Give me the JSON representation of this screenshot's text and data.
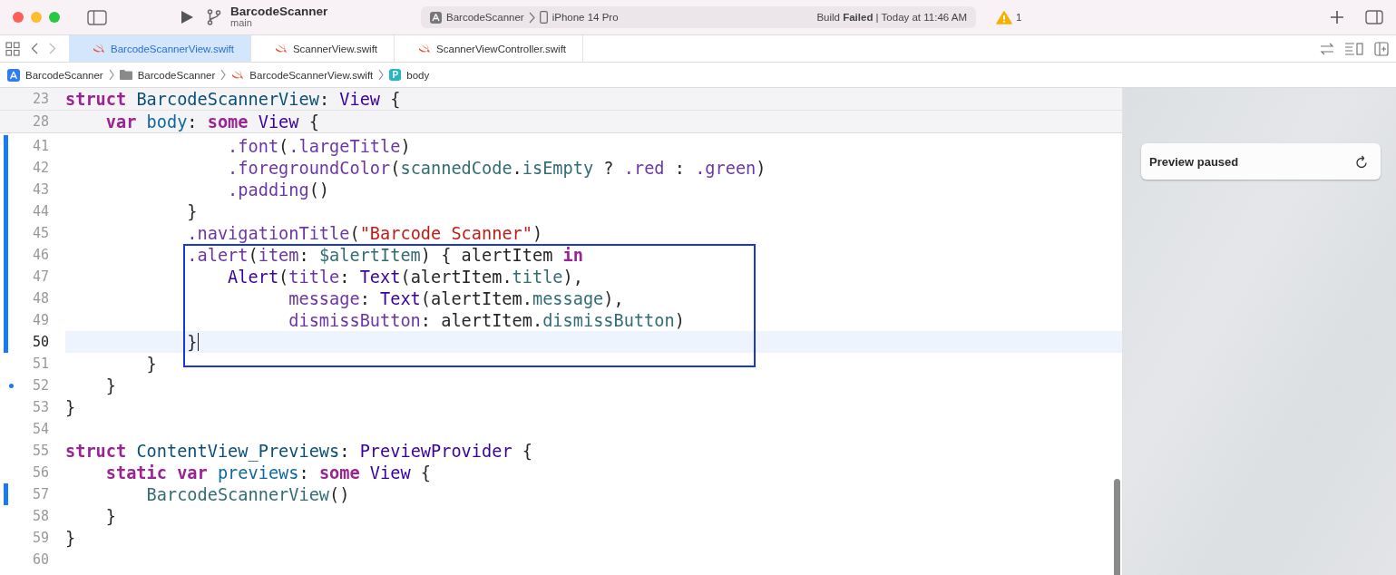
{
  "toolbar": {
    "project": "BarcodeScanner",
    "branch": "main",
    "scheme": "BarcodeScanner",
    "device": "iPhone 14 Pro",
    "status": "Build **Failed** | Today at 11:46 AM",
    "warning_count": "1"
  },
  "tabs": [
    {
      "label": "BarcodeScannerView.swift",
      "selected": true
    },
    {
      "label": "ScannerView.swift",
      "selected": false
    },
    {
      "label": "ScannerViewController.swift",
      "selected": false
    }
  ],
  "breadcrumb": [
    {
      "kind": "app",
      "label": "BarcodeScanner"
    },
    {
      "kind": "folder",
      "label": "BarcodeScanner"
    },
    {
      "kind": "swift",
      "label": "BarcodeScannerView.swift"
    },
    {
      "kind": "property",
      "badge": "P",
      "label": "body"
    }
  ],
  "sticky_lines": [
    {
      "number": "23",
      "tokens": [
        {
          "kind": "kw",
          "text": "struct "
        },
        {
          "kind": "decl",
          "text": "BarcodeScannerView"
        },
        {
          "kind": "p",
          "text": ": "
        },
        {
          "kind": "type",
          "text": "View"
        },
        {
          "kind": "p",
          "text": " {"
        }
      ]
    },
    {
      "number": "28",
      "tokens": [
        {
          "kind": "kw",
          "text": "    var "
        },
        {
          "kind": "var",
          "text": "body"
        },
        {
          "kind": "p",
          "text": ": "
        },
        {
          "kind": "kw",
          "text": "some "
        },
        {
          "kind": "type",
          "text": "View"
        },
        {
          "kind": "p",
          "text": " {"
        }
      ]
    }
  ],
  "lines": [
    {
      "number": "41",
      "changed": true,
      "deletion": false,
      "current": false,
      "boxed": false,
      "tokens": [
        {
          "kind": "member",
          "text": "                .font"
        },
        {
          "kind": "p",
          "text": "("
        },
        {
          "kind": "member",
          "text": ".largeTitle"
        },
        {
          "kind": "p",
          "text": ")"
        }
      ]
    },
    {
      "number": "42",
      "changed": true,
      "deletion": false,
      "current": false,
      "boxed": false,
      "tokens": [
        {
          "kind": "member",
          "text": "                .foregroundColor"
        },
        {
          "kind": "p",
          "text": "("
        },
        {
          "kind": "prop",
          "text": "scannedCode"
        },
        {
          "kind": "p",
          "text": "."
        },
        {
          "kind": "prop",
          "text": "isEmpty"
        },
        {
          "kind": "p",
          "text": " ? "
        },
        {
          "kind": "member",
          "text": ".red"
        },
        {
          "kind": "p",
          "text": " : "
        },
        {
          "kind": "member",
          "text": ".green"
        },
        {
          "kind": "p",
          "text": ")"
        }
      ]
    },
    {
      "number": "43",
      "changed": true,
      "deletion": false,
      "current": false,
      "boxed": false,
      "tokens": [
        {
          "kind": "member",
          "text": "                .padding"
        },
        {
          "kind": "p",
          "text": "()"
        }
      ]
    },
    {
      "number": "44",
      "changed": true,
      "deletion": false,
      "current": false,
      "boxed": false,
      "tokens": [
        {
          "kind": "p",
          "text": "            }"
        }
      ]
    },
    {
      "number": "45",
      "changed": true,
      "deletion": false,
      "current": false,
      "boxed": false,
      "tokens": [
        {
          "kind": "member",
          "text": "            .navigationTitle"
        },
        {
          "kind": "p",
          "text": "("
        },
        {
          "kind": "str",
          "text": "\"Barcode Scanner\""
        },
        {
          "kind": "p",
          "text": ")"
        }
      ]
    },
    {
      "number": "46",
      "changed": true,
      "deletion": false,
      "current": false,
      "boxed": true,
      "tokens": [
        {
          "kind": "member",
          "text": "            .alert"
        },
        {
          "kind": "p",
          "text": "("
        },
        {
          "kind": "member",
          "text": "item"
        },
        {
          "kind": "p",
          "text": ": "
        },
        {
          "kind": "prop",
          "text": "$alertItem"
        },
        {
          "kind": "p",
          "text": ") { alertItem "
        },
        {
          "kind": "kw",
          "text": "in"
        }
      ]
    },
    {
      "number": "47",
      "changed": true,
      "deletion": false,
      "current": false,
      "boxed": true,
      "tokens": [
        {
          "kind": "type",
          "text": "                Alert"
        },
        {
          "kind": "p",
          "text": "("
        },
        {
          "kind": "member",
          "text": "title"
        },
        {
          "kind": "p",
          "text": ": "
        },
        {
          "kind": "type",
          "text": "Text"
        },
        {
          "kind": "p",
          "text": "(alertItem."
        },
        {
          "kind": "prop",
          "text": "title"
        },
        {
          "kind": "p",
          "text": "),"
        }
      ]
    },
    {
      "number": "48",
      "changed": true,
      "deletion": false,
      "current": false,
      "boxed": true,
      "tokens": [
        {
          "kind": "member",
          "text": "                      message"
        },
        {
          "kind": "p",
          "text": ": "
        },
        {
          "kind": "type",
          "text": "Text"
        },
        {
          "kind": "p",
          "text": "(alertItem."
        },
        {
          "kind": "prop",
          "text": "message"
        },
        {
          "kind": "p",
          "text": "),"
        }
      ]
    },
    {
      "number": "49",
      "changed": true,
      "deletion": false,
      "current": false,
      "boxed": true,
      "tokens": [
        {
          "kind": "member",
          "text": "                      dismissButton"
        },
        {
          "kind": "p",
          "text": ": alertItem."
        },
        {
          "kind": "prop",
          "text": "dismissButton"
        },
        {
          "kind": "p",
          "text": ")"
        }
      ]
    },
    {
      "number": "50",
      "changed": true,
      "deletion": false,
      "current": true,
      "boxed": true,
      "tokens": [
        {
          "kind": "p",
          "text": "            }"
        }
      ]
    },
    {
      "number": "51",
      "changed": false,
      "deletion": false,
      "current": false,
      "boxed": false,
      "tokens": [
        {
          "kind": "p",
          "text": "        }"
        }
      ]
    },
    {
      "number": "52",
      "changed": false,
      "deletion": true,
      "current": false,
      "boxed": false,
      "tokens": [
        {
          "kind": "p",
          "text": "    }"
        }
      ]
    },
    {
      "number": "53",
      "changed": false,
      "deletion": false,
      "current": false,
      "boxed": false,
      "tokens": [
        {
          "kind": "p",
          "text": "}"
        }
      ]
    },
    {
      "number": "54",
      "changed": false,
      "deletion": false,
      "current": false,
      "boxed": false
    },
    {
      "number": "55",
      "changed": false,
      "deletion": false,
      "current": false,
      "boxed": false,
      "tokens": [
        {
          "kind": "kw",
          "text": "struct "
        },
        {
          "kind": "decl",
          "text": "ContentView_Previews"
        },
        {
          "kind": "p",
          "text": ": "
        },
        {
          "kind": "type",
          "text": "PreviewProvider"
        },
        {
          "kind": "p",
          "text": " {"
        }
      ]
    },
    {
      "number": "56",
      "changed": false,
      "deletion": false,
      "current": false,
      "boxed": false,
      "tokens": [
        {
          "kind": "kw",
          "text": "    static var "
        },
        {
          "kind": "var",
          "text": "previews"
        },
        {
          "kind": "p",
          "text": ": "
        },
        {
          "kind": "kw",
          "text": "some "
        },
        {
          "kind": "type",
          "text": "View"
        },
        {
          "kind": "p",
          "text": " {"
        }
      ]
    },
    {
      "number": "57",
      "changed": true,
      "deletion": false,
      "current": false,
      "boxed": false,
      "tokens": [
        {
          "kind": "call",
          "text": "        BarcodeScannerView"
        },
        {
          "kind": "p",
          "text": "()"
        }
      ]
    },
    {
      "number": "58",
      "changed": false,
      "deletion": false,
      "current": false,
      "boxed": false,
      "tokens": [
        {
          "kind": "p",
          "text": "    }"
        }
      ]
    },
    {
      "number": "59",
      "changed": false,
      "deletion": false,
      "current": false,
      "boxed": false,
      "tokens": [
        {
          "kind": "p",
          "text": "}"
        }
      ]
    },
    {
      "number": "60",
      "changed": false,
      "deletion": false,
      "current": false,
      "boxed": false
    }
  ],
  "preview": {
    "message": "Preview paused"
  }
}
